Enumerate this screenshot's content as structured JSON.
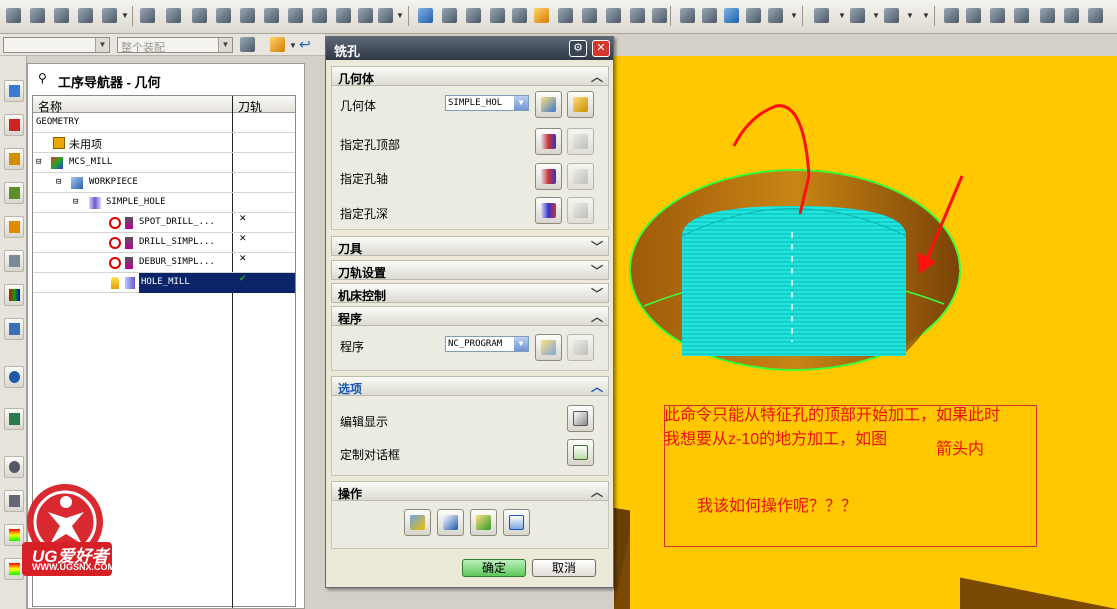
{
  "toolbar": {
    "dropdown_value": "整个装配"
  },
  "navigator": {
    "title": "工序导航器 - 几何",
    "col_name": "名称",
    "col_toolpath": "刀轨",
    "rows": [
      {
        "label": "GEOMETRY",
        "indent": 0,
        "mark": ""
      },
      {
        "label": "未用项",
        "indent": 1,
        "mark": ""
      },
      {
        "label": "MCS_MILL",
        "indent": 1,
        "mark": ""
      },
      {
        "label": "WORKPIECE",
        "indent": 2,
        "mark": ""
      },
      {
        "label": "SIMPLE_HOLE",
        "indent": 3,
        "mark": ""
      },
      {
        "label": "SPOT_DRILL_...",
        "indent": 4,
        "mark": "✕"
      },
      {
        "label": "DRILL_SIMPL...",
        "indent": 4,
        "mark": "✕"
      },
      {
        "label": "DEBUR_SIMPL...",
        "indent": 4,
        "mark": "✕"
      },
      {
        "label": "HOLE_MILL",
        "indent": 4,
        "mark": "✔"
      }
    ]
  },
  "dialog": {
    "title": "铣孔",
    "sections": {
      "geometry": "几何体",
      "tool": "刀具",
      "toolpath_settings": "刀轨设置",
      "machine_control": "机床控制",
      "program": "程序",
      "options": "选项",
      "actions": "操作"
    },
    "geometry_label": "几何体",
    "geometry_value": "SIMPLE_HOL",
    "specify_hole_top": "指定孔顶部",
    "specify_hole_axis": "指定孔轴",
    "specify_hole_depth": "指定孔深",
    "program_label": "程序",
    "program_value": "NC_PROGRAM",
    "edit_display": "编辑显示",
    "custom_dialog": "定制对话框",
    "ok": "确定",
    "cancel": "取消"
  },
  "annotation": {
    "line1": "此命令只能从特征孔的顶部开始加工，如果此时",
    "line2": "我想要从z-10的地方加工，如图",
    "line2b": "箭头内",
    "line3": "我该如何操作呢？？？"
  },
  "logo": {
    "brand": "UG爱好者",
    "url": "WWW.UGSNX.COM"
  },
  "colors": {
    "viewport_bg": "#ffc800",
    "annotation_red": "#e81010",
    "toolpath_cyan": "#19e6e0",
    "selection_blue": "#0a246a"
  }
}
